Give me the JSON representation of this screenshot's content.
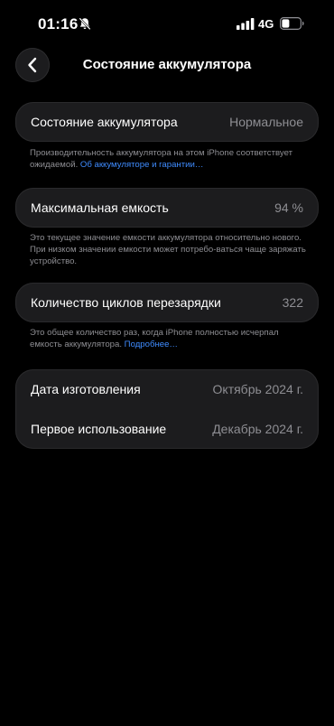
{
  "status_bar": {
    "time": "01:16",
    "network": "4G"
  },
  "nav": {
    "title": "Состояние аккумулятора"
  },
  "battery_health": {
    "label": "Состояние аккумулятора",
    "value": "Нормальное",
    "footnote": "Производительность аккумулятора на этом iPhone соответствует ожидаемой. ",
    "link": "Об аккумуляторе и гарантии…"
  },
  "max_capacity": {
    "label": "Максимальная емкость",
    "value": "94 %",
    "footnote": "Это текущее значение емкости аккумулятора относительно нового. При низком значении емкости может потребо-ваться чаще заряжать устройство."
  },
  "cycle_count": {
    "label": "Количество циклов перезарядки",
    "value": "322",
    "footnote": "Это общее количество раз, когда iPhone полностью исчерпал емкость аккумулятора. ",
    "link": "Подробнее…"
  },
  "dates": {
    "manufacture_label": "Дата изготовления",
    "manufacture_value": "Октябрь 2024 г.",
    "first_use_label": "Первое использование",
    "first_use_value": "Декабрь 2024 г."
  },
  "icons": {
    "bell": "bell-slash-icon",
    "signal": "cellular-signal-icon",
    "battery": "battery-icon",
    "back": "chevron-left-icon"
  }
}
